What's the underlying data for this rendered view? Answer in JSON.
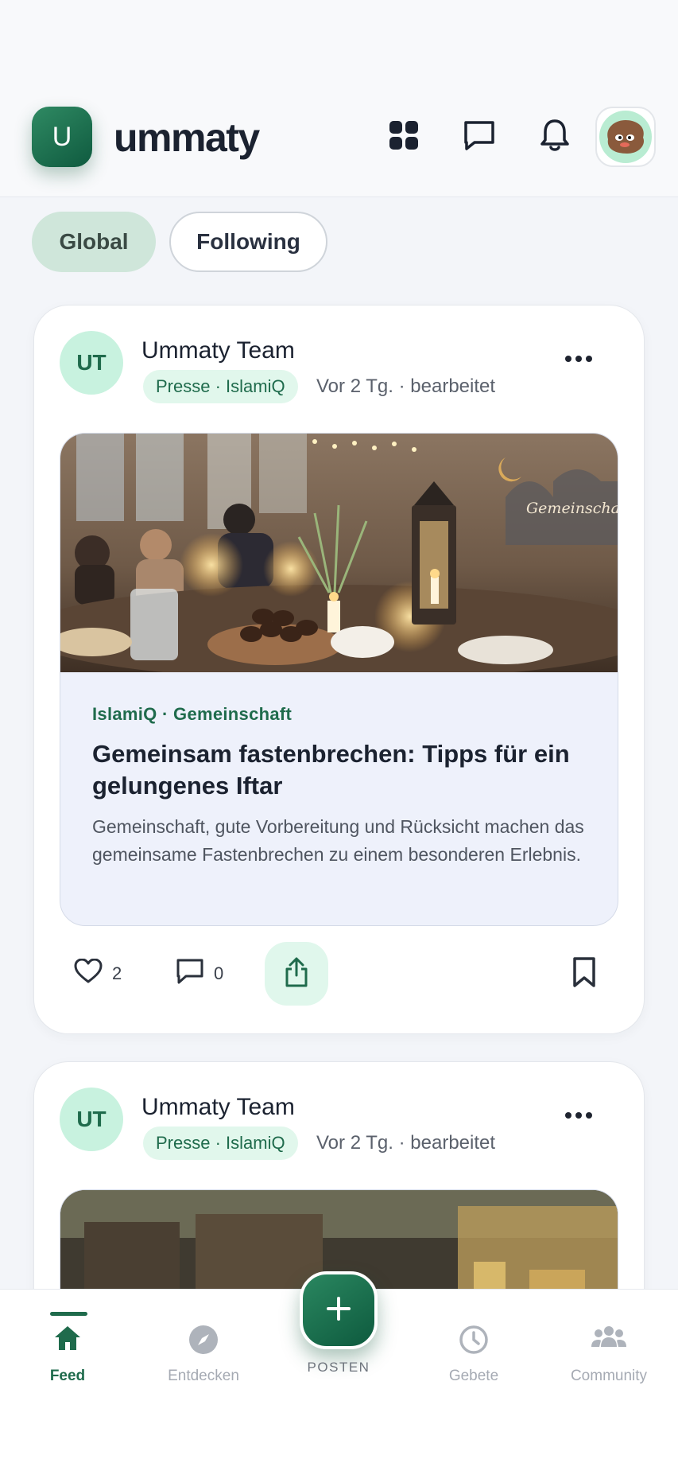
{
  "app": {
    "logo_letter": "U",
    "name": "ummaty"
  },
  "header": {
    "icons": [
      "grid-icon",
      "chat-icon",
      "bell-icon",
      "profile-avatar"
    ]
  },
  "filters": {
    "global": "Global",
    "following": "Following",
    "active": "Global"
  },
  "posts": [
    {
      "author_initials": "UT",
      "author": "Ummaty Team",
      "tag": "Presse · IslamiQ",
      "meta": "Vor 2 Tg. · bearbeitet",
      "article": {
        "source": "IslamiQ · Gemeinschaft",
        "title": "Gemeinsam fastenbrechen: Tipps für ein gelungenes Iftar",
        "description": "Gemeinschaft, gute Vorbereitung und Rücksicht machen das gemeinsame Fastenbrechen zu einem besonderen Erlebnis.",
        "image_text": "Gemeinschaft Stärkt Uns"
      },
      "likes": "2",
      "comments": "0"
    },
    {
      "author_initials": "UT",
      "author": "Ummaty Team",
      "tag": "Presse · IslamiQ",
      "meta": "Vor 2 Tg. · bearbeitet"
    }
  ],
  "nav": {
    "items": [
      {
        "label": "Feed",
        "icon": "home-icon",
        "active": true
      },
      {
        "label": "Entdecken",
        "icon": "compass-icon",
        "active": false
      },
      {
        "label": "Gebete",
        "icon": "clock-icon",
        "active": false
      },
      {
        "label": "Community",
        "icon": "people-icon",
        "active": false
      }
    ],
    "fab_label": "POSTEN"
  },
  "colors": {
    "brand": "#1f6b4c",
    "brand_light": "#e1f7ec",
    "pill_active": "#cfe6da"
  }
}
